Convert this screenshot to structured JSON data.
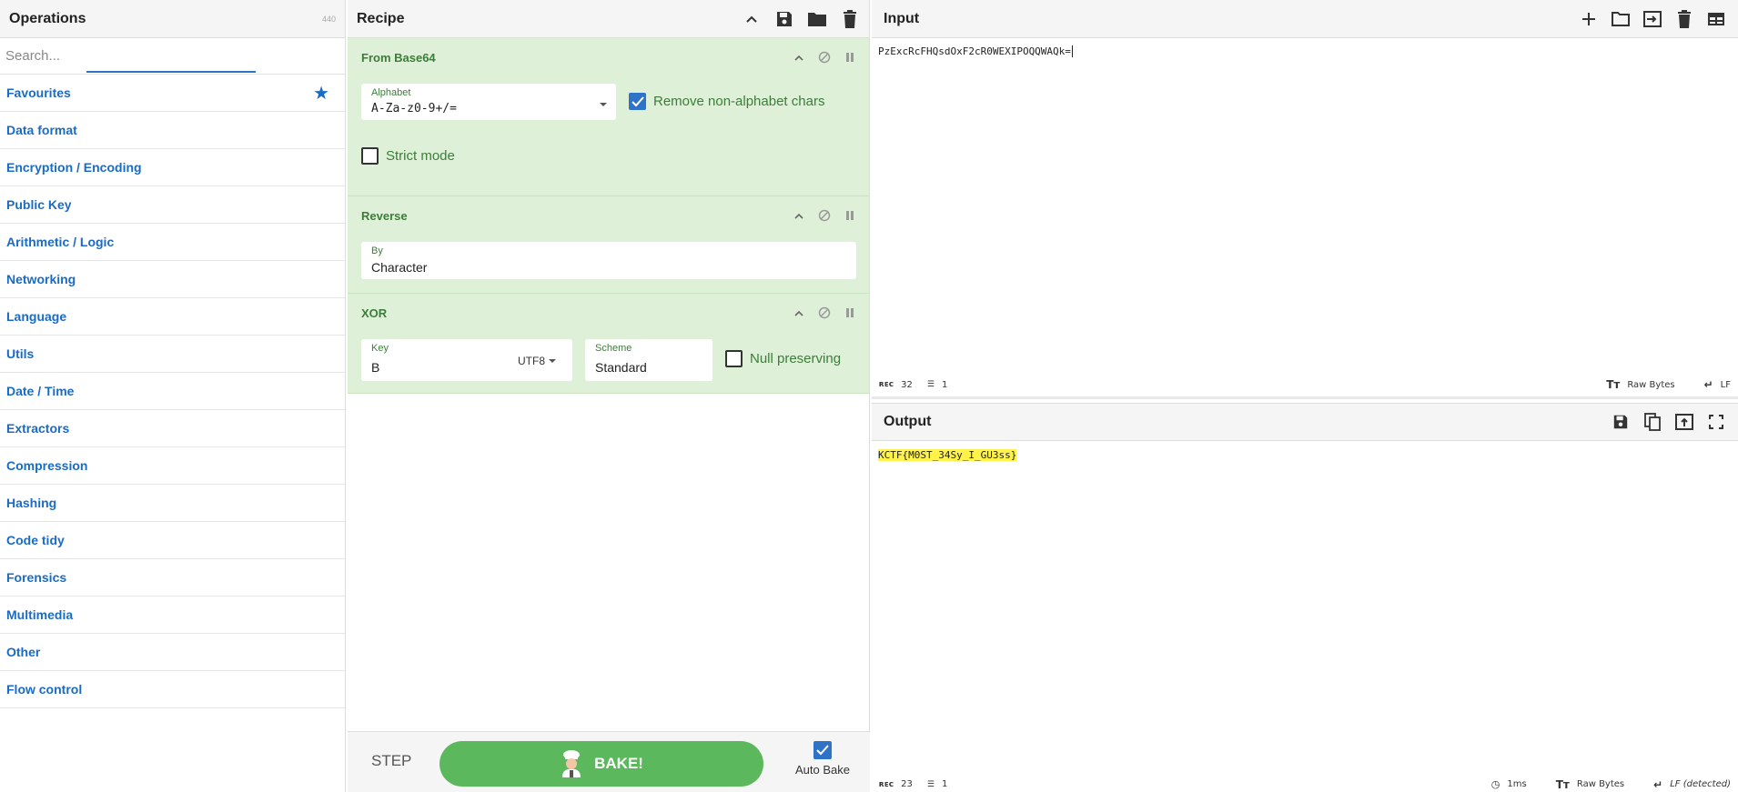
{
  "operations": {
    "title": "Operations",
    "count": "440",
    "search_placeholder": "Search...",
    "categories": [
      "Favourites",
      "Data format",
      "Encryption / Encoding",
      "Public Key",
      "Arithmetic / Logic",
      "Networking",
      "Language",
      "Utils",
      "Date / Time",
      "Extractors",
      "Compression",
      "Hashing",
      "Code tidy",
      "Forensics",
      "Multimedia",
      "Other",
      "Flow control"
    ]
  },
  "recipe": {
    "title": "Recipe",
    "ops": [
      {
        "name": "From Base64",
        "alphabet_label": "Alphabet",
        "alphabet_value": "A-Za-z0-9+/=",
        "remove_label": "Remove non-alphabet chars",
        "remove_checked": true,
        "strict_label": "Strict mode",
        "strict_checked": false
      },
      {
        "name": "Reverse",
        "by_label": "By",
        "by_value": "Character"
      },
      {
        "name": "XOR",
        "key_label": "Key",
        "key_value": "B",
        "key_encoding": "UTF8",
        "scheme_label": "Scheme",
        "scheme_value": "Standard",
        "null_label": "Null preserving",
        "null_checked": false
      }
    ],
    "step_label": "STEP",
    "bake_label": "BAKE!",
    "autobake_label": "Auto Bake",
    "autobake_checked": true
  },
  "input": {
    "title": "Input",
    "text": "PzExcRcFHQsdOxF2cR0WEXIPOQQWAQk=",
    "status": {
      "chars": "32",
      "lines": "1",
      "encoding": "Raw Bytes",
      "eol": "LF"
    }
  },
  "output": {
    "title": "Output",
    "text": "KCTF{M0ST_34Sy_I_GU3ss}",
    "status": {
      "chars": "23",
      "lines": "1",
      "time": "1ms",
      "encoding": "Raw Bytes",
      "eol": "LF (detected)"
    }
  },
  "colors": {
    "accent_blue": "#1a6bc5",
    "op_bg": "#dff0d8",
    "op_text": "#3c7d3a",
    "bake_green": "#5cb85c",
    "highlight": "#fff34a"
  }
}
